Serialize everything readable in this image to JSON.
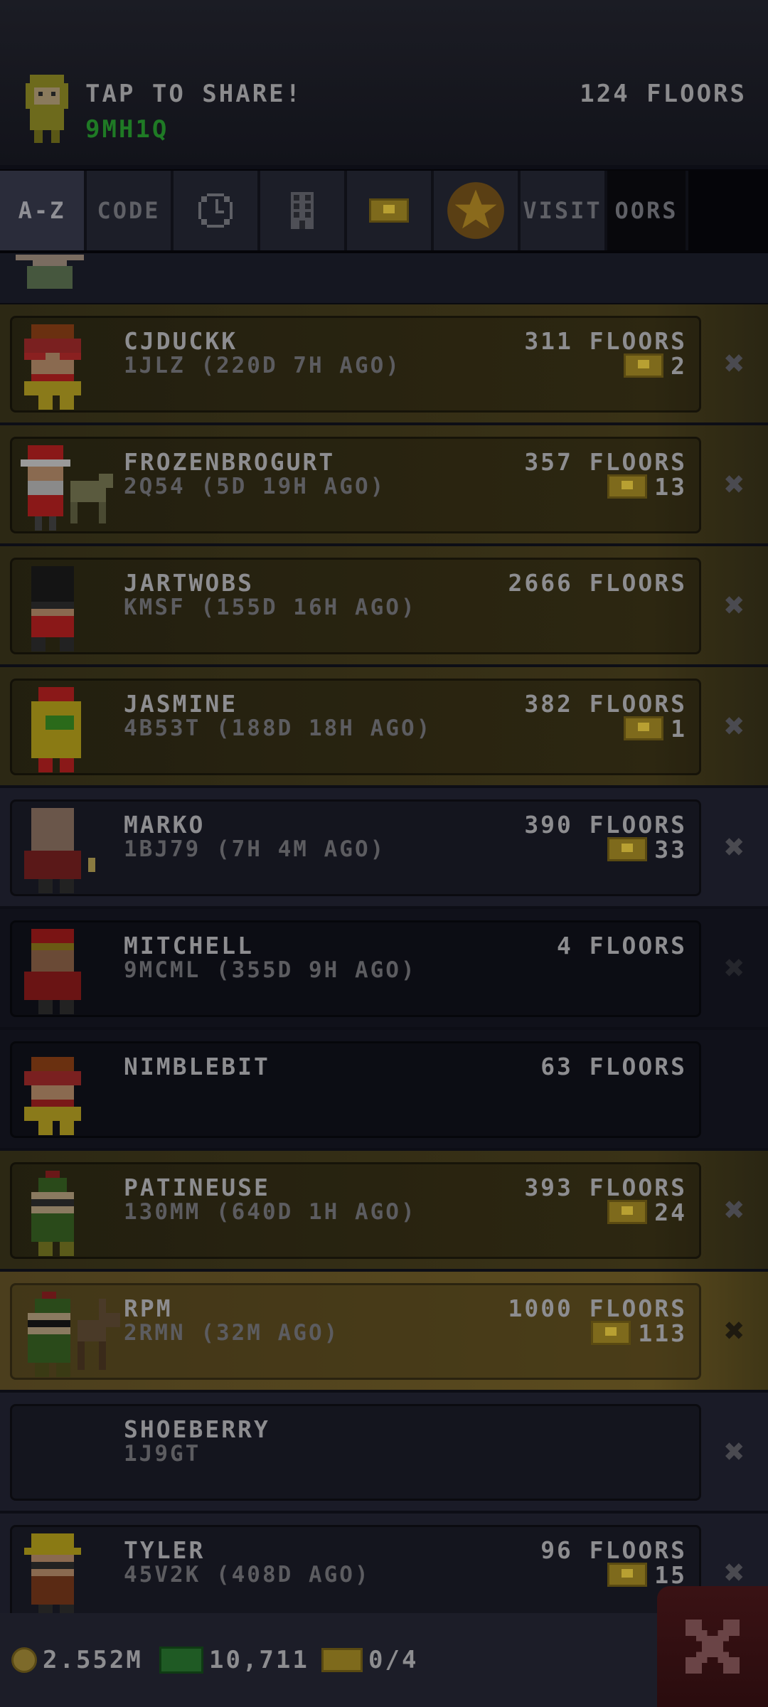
{
  "header": {
    "share_label": "TAP TO SHARE!",
    "share_code": "9MH1Q",
    "my_floors": "124 FLOORS"
  },
  "tabs": [
    {
      "label": "A-Z",
      "active": true
    },
    {
      "label": "CODE",
      "active": false
    },
    {
      "icon": "clock-icon",
      "active": false
    },
    {
      "icon": "building-icon",
      "active": false
    },
    {
      "icon": "bux-icon",
      "active": false
    },
    {
      "icon": "star-icon",
      "active": false
    },
    {
      "label": "VISIT",
      "active": false
    },
    {
      "label": "OORS",
      "active": false
    }
  ],
  "friends": [
    {
      "name": "CJDUCKK",
      "code": "1JLZ (220D 7H AGO)",
      "floors": "311 FLOORS",
      "bux": "2",
      "style": "gold"
    },
    {
      "name": "FROZENBROGURT",
      "code": "2Q54 (5D 19H AGO)",
      "floors": "357 FLOORS",
      "bux": "13",
      "style": "gold"
    },
    {
      "name": "JARTWOBS",
      "code": "KMSF (155D 16H AGO)",
      "floors": "2666 FLOORS",
      "bux": "",
      "style": "gold"
    },
    {
      "name": "JASMINE",
      "code": "4B53T (188D 18H AGO)",
      "floors": "382 FLOORS",
      "bux": "1",
      "style": "gold"
    },
    {
      "name": "MARKO",
      "code": "1BJ79 (7H 4M AGO)",
      "floors": "390 FLOORS",
      "bux": "33",
      "style": "blue"
    },
    {
      "name": "MITCHELL",
      "code": "9MCML (355D 9H AGO)",
      "floors": "4 FLOORS",
      "bux": "",
      "style": "dark"
    },
    {
      "name": "NIMBLEBIT",
      "code": "",
      "floors": "63 FLOORS",
      "bux": "",
      "style": "dark"
    },
    {
      "name": "PATINEUSE",
      "code": "130MM (640D 1H AGO)",
      "floors": "393 FLOORS",
      "bux": "24",
      "style": "gold"
    },
    {
      "name": "RPM",
      "code": "2RMN (32M AGO)",
      "floors": "1000 FLOORS",
      "bux": "113",
      "style": "bright"
    },
    {
      "name": "SHOEBERRY",
      "code": "1J9GT",
      "floors": "",
      "bux": "",
      "style": "blue"
    },
    {
      "name": "TYLER",
      "code": "45V2K (408D AGO)",
      "floors": "96 FLOORS",
      "bux": "15",
      "style": "blue"
    }
  ],
  "footer": {
    "coins": "2.552M",
    "cash": "10,711",
    "bux": "0/4"
  },
  "colors": {
    "share_code": "#1f7a25",
    "close_button": "#3a1214"
  }
}
